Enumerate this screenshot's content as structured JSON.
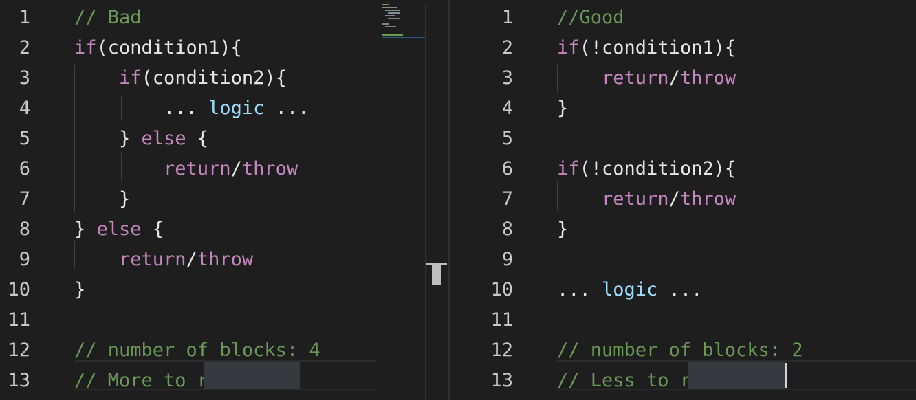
{
  "left_editor": {
    "lines": [
      {
        "n": "1",
        "tokens": [
          {
            "t": "// Bad",
            "c": "comment"
          }
        ]
      },
      {
        "n": "2",
        "tokens": [
          {
            "t": "if",
            "c": "kw"
          },
          {
            "t": "(condition1){",
            "c": "plain"
          }
        ]
      },
      {
        "n": "3",
        "tokens": [
          {
            "t": "    ",
            "c": "plain"
          },
          {
            "t": "if",
            "c": "kw"
          },
          {
            "t": "(condition2){",
            "c": "plain"
          }
        ]
      },
      {
        "n": "4",
        "tokens": [
          {
            "t": "        ... ",
            "c": "plain"
          },
          {
            "t": "logic",
            "c": "fn"
          },
          {
            "t": " ...",
            "c": "plain"
          }
        ]
      },
      {
        "n": "5",
        "tokens": [
          {
            "t": "    } ",
            "c": "plain"
          },
          {
            "t": "else",
            "c": "kw"
          },
          {
            "t": " {",
            "c": "plain"
          }
        ]
      },
      {
        "n": "6",
        "tokens": [
          {
            "t": "        ",
            "c": "plain"
          },
          {
            "t": "return",
            "c": "kw"
          },
          {
            "t": "/",
            "c": "plain"
          },
          {
            "t": "throw",
            "c": "kw"
          }
        ]
      },
      {
        "n": "7",
        "tokens": [
          {
            "t": "    }",
            "c": "plain"
          }
        ]
      },
      {
        "n": "8",
        "tokens": [
          {
            "t": "} ",
            "c": "plain"
          },
          {
            "t": "else",
            "c": "kw"
          },
          {
            "t": " {",
            "c": "plain"
          }
        ]
      },
      {
        "n": "9",
        "tokens": [
          {
            "t": "    ",
            "c": "plain"
          },
          {
            "t": "return",
            "c": "kw"
          },
          {
            "t": "/",
            "c": "plain"
          },
          {
            "t": "throw",
            "c": "kw"
          }
        ]
      },
      {
        "n": "10",
        "tokens": [
          {
            "t": "}",
            "c": "plain"
          }
        ]
      },
      {
        "n": "11",
        "tokens": []
      },
      {
        "n": "12",
        "tokens": [
          {
            "t": "// number of blocks: 4",
            "c": "comment"
          }
        ]
      },
      {
        "n": "13",
        "tokens": [
          {
            "t": "// More to remember",
            "c": "comment"
          }
        ]
      }
    ]
  },
  "right_editor": {
    "lines": [
      {
        "n": "1",
        "tokens": [
          {
            "t": "//Good",
            "c": "comment"
          }
        ]
      },
      {
        "n": "2",
        "tokens": [
          {
            "t": "if",
            "c": "kw"
          },
          {
            "t": "(!condition1){",
            "c": "plain"
          }
        ]
      },
      {
        "n": "3",
        "tokens": [
          {
            "t": "    ",
            "c": "plain"
          },
          {
            "t": "return",
            "c": "kw"
          },
          {
            "t": "/",
            "c": "plain"
          },
          {
            "t": "throw",
            "c": "kw"
          }
        ]
      },
      {
        "n": "4",
        "tokens": [
          {
            "t": "}",
            "c": "plain"
          }
        ]
      },
      {
        "n": "5",
        "tokens": []
      },
      {
        "n": "6",
        "tokens": [
          {
            "t": "if",
            "c": "kw"
          },
          {
            "t": "(!condition2){",
            "c": "plain"
          }
        ]
      },
      {
        "n": "7",
        "tokens": [
          {
            "t": "    ",
            "c": "plain"
          },
          {
            "t": "return",
            "c": "kw"
          },
          {
            "t": "/",
            "c": "plain"
          },
          {
            "t": "throw",
            "c": "kw"
          }
        ]
      },
      {
        "n": "8",
        "tokens": [
          {
            "t": "}",
            "c": "plain"
          }
        ]
      },
      {
        "n": "9",
        "tokens": []
      },
      {
        "n": "10",
        "tokens": [
          {
            "t": "... ",
            "c": "plain"
          },
          {
            "t": "logic",
            "c": "fn"
          },
          {
            "t": " ...",
            "c": "plain"
          }
        ]
      },
      {
        "n": "11",
        "tokens": []
      },
      {
        "n": "12",
        "tokens": [
          {
            "t": "// number of blocks: 2",
            "c": "comment"
          }
        ]
      },
      {
        "n": "13",
        "tokens": [
          {
            "t": "// Less to remember",
            "c": "comment"
          }
        ]
      }
    ]
  },
  "colors": {
    "background": "#1e1e1e",
    "comment": "#6a9955",
    "keyword": "#c586c0",
    "function": "#9cdcfe",
    "text": "#e6e6e6",
    "line_number": "#c8c8c8"
  },
  "icons": {
    "scroll_marker": "scrollbar-position-marker-icon"
  }
}
